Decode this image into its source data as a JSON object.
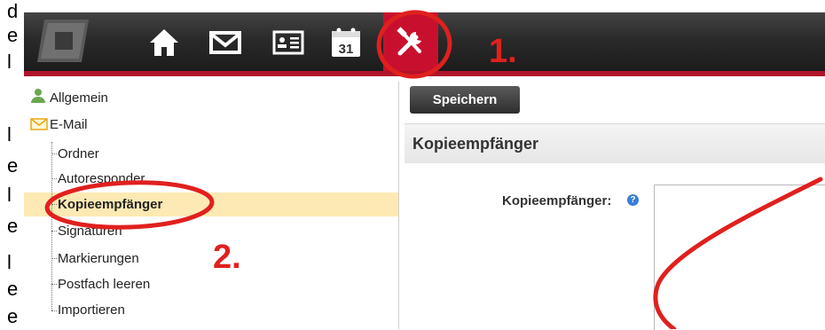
{
  "left_margin_letters": [
    "d",
    "e",
    "l",
    "l",
    "e",
    "l",
    "e",
    "l",
    "e",
    "e"
  ],
  "toolbar": {
    "icons": [
      "home-icon",
      "mail-icon",
      "contacts-icon",
      "calendar-icon",
      "tools-icon"
    ],
    "calendar_day": "31",
    "active_icon": "tools-icon",
    "accent_color": "#c8102e"
  },
  "annotations": {
    "step1": "1.",
    "step2": "2.",
    "color": "#e0201e"
  },
  "sidebar": {
    "allgemein": "Allgemein",
    "email": "E-Mail",
    "subitems": [
      "Ordner",
      "Autoresponder",
      "Kopieempfänger",
      "Signaturen",
      "Markierungen",
      "Postfach leeren",
      "Importieren"
    ],
    "active_index": 2
  },
  "main": {
    "save_label": "Speichern",
    "section_title": "Kopieempfänger",
    "field_label": "Kopieempfänger:",
    "help": "?"
  }
}
